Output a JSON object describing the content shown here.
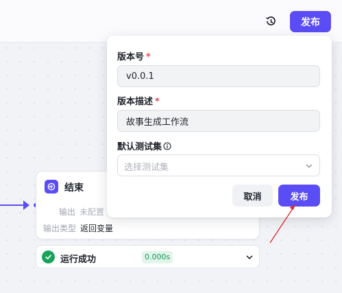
{
  "toolbar": {
    "history_icon": "history-clock-icon",
    "publish_label": "发布"
  },
  "end_node": {
    "icon": "exit-icon",
    "title": "结束",
    "output_key": "输出",
    "output_value": "未配置",
    "output_type_key": "输出类型",
    "output_type_value": "返回变量"
  },
  "run_status": {
    "icon": "check-circle-icon",
    "text": "运行成功",
    "duration": "0.000s"
  },
  "publish_popover": {
    "version_label": "版本号",
    "version_value": "v0.0.1",
    "desc_label": "版本描述",
    "desc_value": "故事生成工作流",
    "testset_label": "默认测试集",
    "testset_placeholder": "选择测试集",
    "required_mark": "*",
    "cancel_label": "取消",
    "publish_label": "发布"
  },
  "colors": {
    "accent": "#5b4df5",
    "success": "#19a35a",
    "required": "#e5484d",
    "annotation": "#e0252b"
  }
}
